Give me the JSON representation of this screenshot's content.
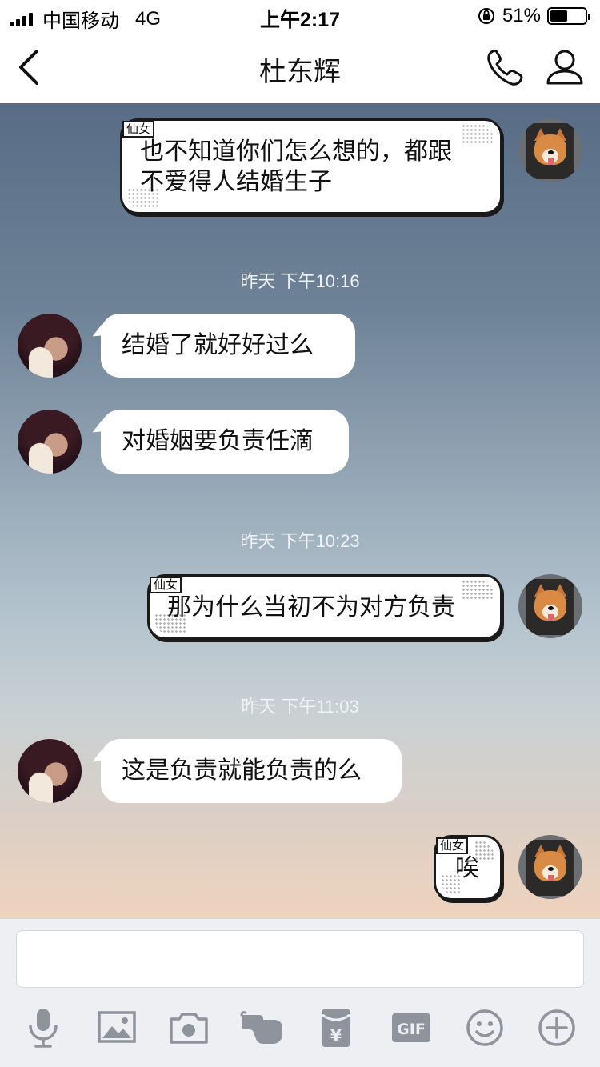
{
  "status_bar": {
    "carrier": "中国移动",
    "network": "4G",
    "time": "上午2:17",
    "battery": "51%",
    "battery_level": 0.51
  },
  "nav": {
    "title": "杜东辉",
    "back_icon": "chevron-left-icon",
    "call_icon": "phone-icon",
    "profile_icon": "person-icon"
  },
  "messages": {
    "m1": {
      "tag": "仙女",
      "line1": "也不知道你们怎么想的，都跟",
      "line2": "不爱得人结婚生子"
    },
    "ts1": "昨天 下午10:16",
    "m2": "结婚了就好好过么",
    "m3": "对婚姻要负责任滴",
    "ts2": "昨天 下午10:23",
    "m4": {
      "tag": "仙女",
      "text": "那为什么当初不为对方负责"
    },
    "ts3": "昨天 下午11:03",
    "m5": "这是负责就能负责的么",
    "m6": {
      "tag": "仙女",
      "text": "唉"
    }
  },
  "input": {
    "placeholder": ""
  },
  "toolbar": {
    "icons": [
      "microphone-icon",
      "image-icon",
      "camera-icon",
      "poke-hand-icon",
      "red-packet-icon",
      "gif-icon",
      "emoji-icon",
      "plus-icon"
    ],
    "gif_label": "GIF",
    "red_packet_symbol": "¥"
  }
}
